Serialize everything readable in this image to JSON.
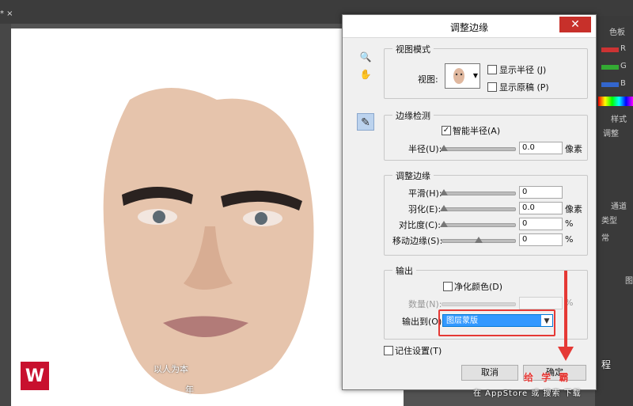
{
  "app": {
    "doc_tab_marker": "* ×",
    "panel": {
      "color_tab": "色板",
      "channels": [
        "R",
        "G",
        "B"
      ],
      "style_tab": "样式",
      "adjust_label": "调整",
      "layers_tab": "通道",
      "kind_label": "类型",
      "normal_label": "常",
      "layer_label": "图"
    },
    "canvas_overlay": {
      "logo_text": "W",
      "slogan_1": "以人为本",
      "slogan_2": "年"
    },
    "watermark": {
      "line1": "程",
      "line2": "在 AppStore 或 搜索 下载",
      "annotation": "给 学 霸"
    }
  },
  "dialog": {
    "title": "调整边缘",
    "close_glyph": "✕",
    "tools": {
      "zoom": "🔍",
      "hand": "✋",
      "brush": "✎"
    },
    "view_mode": {
      "group_title": "视图模式",
      "view_label": "视图:",
      "show_radius": "显示半径 (J)",
      "show_original": "显示原稿 (P)",
      "show_radius_checked": false,
      "show_original_checked": false
    },
    "edge_detection": {
      "group_title": "边缘检测",
      "smart_radius": "智能半径(A)",
      "smart_radius_checked": true,
      "radius_label": "半径(U):",
      "radius_value": "0.0",
      "radius_unit": "像素"
    },
    "adjust_edge": {
      "group_title": "调整边缘",
      "smooth_label": "平滑(H):",
      "smooth_value": "0",
      "feather_label": "羽化(E):",
      "feather_value": "0.0",
      "feather_unit": "像素",
      "contrast_label": "对比度(C):",
      "contrast_value": "0",
      "contrast_unit": "%",
      "shift_label": "移动边缘(S):",
      "shift_value": "0",
      "shift_unit": "%"
    },
    "output": {
      "group_title": "输出",
      "decontaminate": "净化颜色(D)",
      "decontaminate_checked": false,
      "amount_label": "数量(N):",
      "amount_unit": "%",
      "output_to_label": "输出到(O):",
      "output_to_value": "图层蒙版"
    },
    "remember": {
      "label": "记住设置(T)",
      "checked": false
    },
    "buttons": {
      "cancel": "取消",
      "ok": "确定"
    }
  },
  "colors": {
    "accent_red": "#e53935",
    "selection_blue": "#3399ff"
  }
}
